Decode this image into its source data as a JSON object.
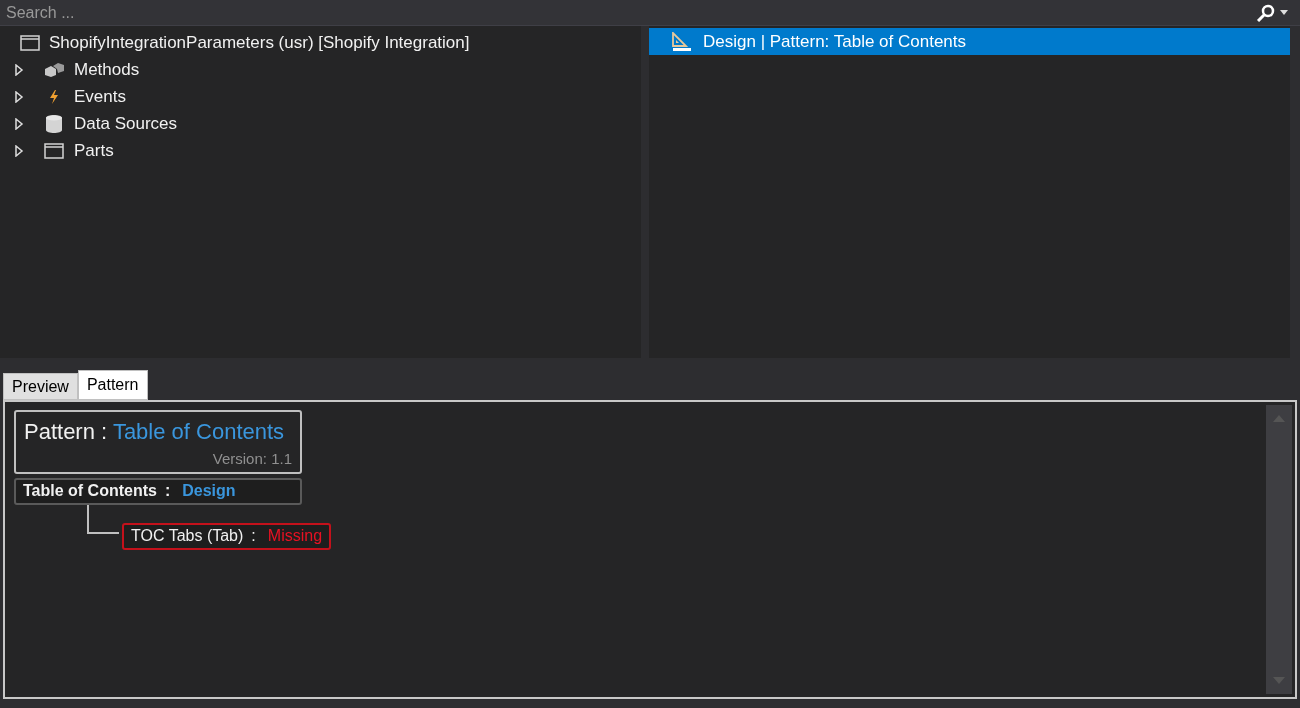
{
  "search": {
    "placeholder": "Search ..."
  },
  "tree": {
    "label": "ShopifyIntegrationParameters (usr) [Shopify Integration]",
    "kind": "form",
    "children": [
      {
        "label": "Methods",
        "kind": "methods",
        "expanded": false
      },
      {
        "label": "Events",
        "kind": "events",
        "expanded": false
      },
      {
        "label": "Data Sources",
        "kind": "datasources",
        "expanded": false
      },
      {
        "label": "Parts",
        "kind": "parts",
        "expanded": false
      }
    ]
  },
  "patterns_list": [
    {
      "label": "Design | Pattern: Table of Contents",
      "selected": true
    }
  ],
  "tabs": [
    {
      "label": "Preview",
      "selected": false
    },
    {
      "label": "Pattern",
      "selected": true
    }
  ],
  "pattern": {
    "prefix": "Pattern :",
    "name": "Table of Contents",
    "version_label": "Version:",
    "version": "1.1"
  },
  "nodes": [
    {
      "label": "Table of Contents",
      "separator": ":",
      "value": "Design",
      "kind": "ok",
      "children": [
        {
          "label": "TOC Tabs  (Tab)",
          "separator": ":",
          "value": "Missing",
          "kind": "missing"
        }
      ]
    }
  ]
}
